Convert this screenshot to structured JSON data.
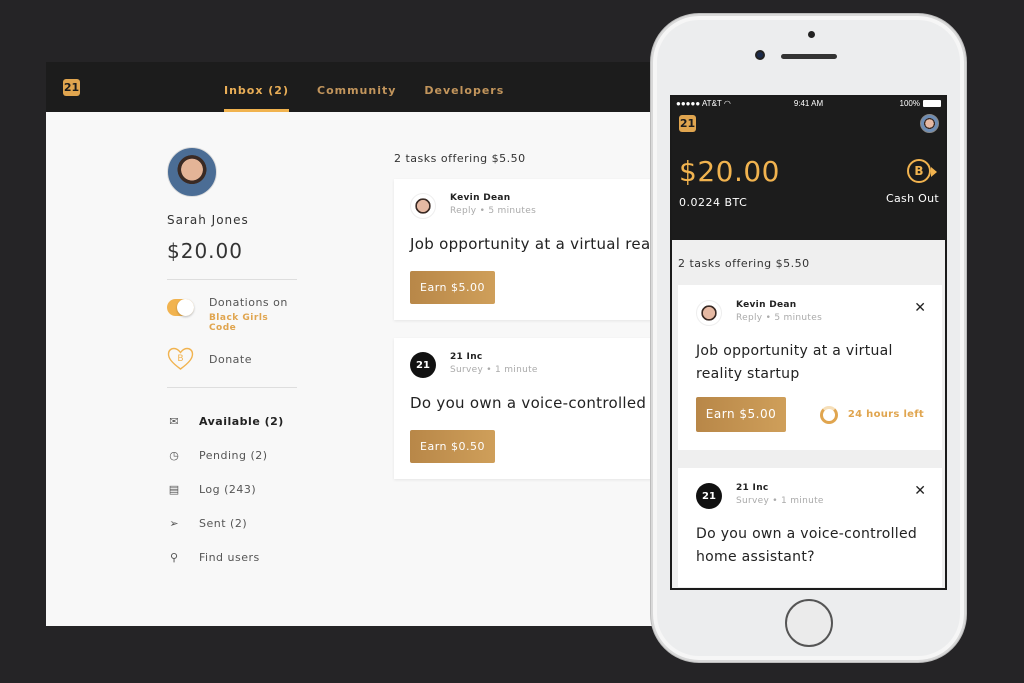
{
  "desktop": {
    "logo_glyph": "21",
    "tabs": [
      {
        "label": "Inbox (2)",
        "active": true
      },
      {
        "label": "Community",
        "active": false
      },
      {
        "label": "Developers",
        "active": false
      }
    ],
    "profile": {
      "name": "Sarah Jones",
      "balance": "$20.00"
    },
    "donations": {
      "label": "Donations on",
      "org": "Black Girls Code",
      "enabled": true,
      "donate_label": "Donate",
      "donate_icon_glyph": "B"
    },
    "nav": [
      {
        "icon": "mail-icon",
        "glyph": "✉",
        "label": "Available (2)",
        "active": true
      },
      {
        "icon": "clock-icon",
        "glyph": "◷",
        "label": "Pending (2)",
        "active": false
      },
      {
        "icon": "log-icon",
        "glyph": "▤",
        "label": "Log (243)",
        "active": false
      },
      {
        "icon": "send-icon",
        "glyph": "➢",
        "label": "Sent (2)",
        "active": false
      },
      {
        "icon": "search-icon",
        "glyph": "⚲",
        "label": "Find users",
        "active": false
      }
    ],
    "feed": {
      "title": "2 tasks offering $5.50",
      "tasks": [
        {
          "sender": "Kevin Dean",
          "type": "Reply",
          "time": "5 minutes",
          "sub": "Reply • 5 minutes",
          "title": "Job opportunity at a virtual reality startup",
          "button": "Earn $5.00"
        },
        {
          "sender": "21 Inc",
          "type": "Survey",
          "time": "1 minute",
          "sub": "Survey • 1 minute",
          "title": "Do you own a voice-controlled home assistant?",
          "button": "Earn $0.50"
        }
      ]
    }
  },
  "phone": {
    "status_bar": {
      "carrier": "●●●●● AT&T",
      "wifi_glyph": "◠",
      "time": "9:41 AM",
      "battery": "100%"
    },
    "logo_glyph": "21",
    "balance": "$20.00",
    "btc": "0.0224 BTC",
    "cashout_label": "Cash Out",
    "cashout_glyph": "B",
    "feed": {
      "title": "2 tasks offering $5.50",
      "tasks": [
        {
          "sender": "Kevin Dean",
          "sub": "Reply • 5 minutes",
          "title": "Job opportunity at a virtual reality startup",
          "button": "Earn $5.00",
          "timer": "24 hours left",
          "close": "✕"
        },
        {
          "sender": "21 Inc",
          "sub": "Survey • 1 minute",
          "title": "Do you own a voice-controlled home assistant?",
          "close": "✕"
        }
      ]
    }
  },
  "colors": {
    "accent": "#f1b34f",
    "button_gold": "#c0904e",
    "header_dark": "#1c1c1c",
    "background": "#252426"
  }
}
